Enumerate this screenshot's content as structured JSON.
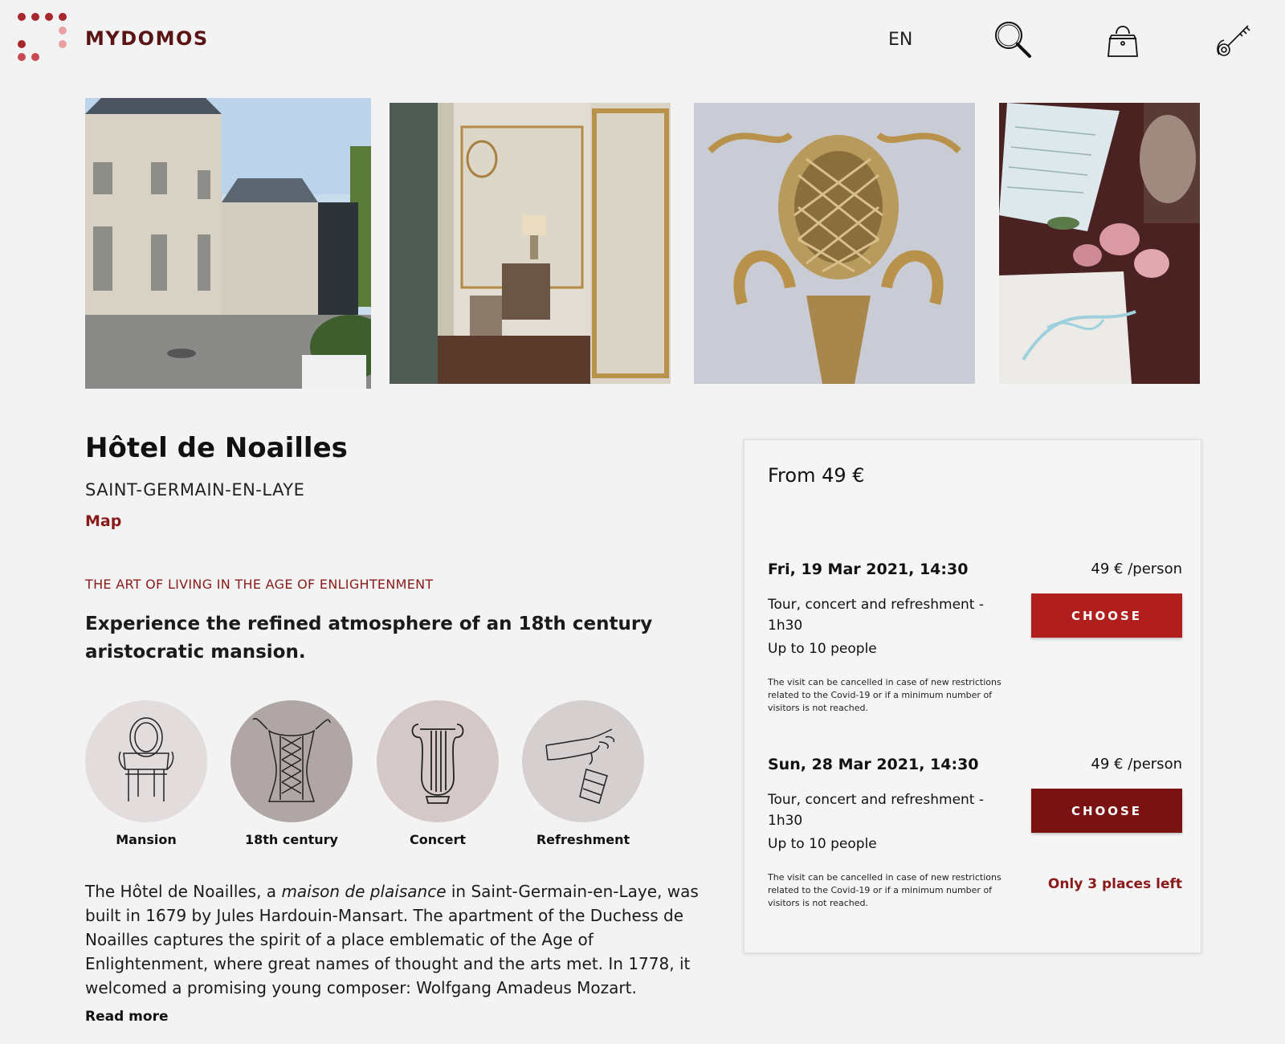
{
  "header": {
    "brand": "MYDOMOS",
    "language": "EN",
    "icons": [
      "search-icon",
      "bag-icon",
      "key-icon"
    ]
  },
  "gallery": [
    {
      "name": "courtyard-photo"
    },
    {
      "name": "salon-photo"
    },
    {
      "name": "gilded-ornament-photo"
    },
    {
      "name": "flowers-invitation-photo"
    }
  ],
  "venue": {
    "title": "Hôtel de Noailles",
    "city": "SAINT-GERMAIN-EN-LAYE",
    "map_link": "Map",
    "tagline": "THE ART OF LIVING IN THE AGE OF ENLIGHTENMENT",
    "lead": "Experience the refined atmosphere of an 18th century aristocratic mansion.",
    "features": [
      {
        "label": "Mansion",
        "icon": "armchair-icon",
        "color": "#e2dcdc"
      },
      {
        "label": "18th century",
        "icon": "corset-icon",
        "color": "#b0a6a6"
      },
      {
        "label": "Concert",
        "icon": "lyre-icon",
        "color": "#d4c8c8"
      },
      {
        "label": "Refreshment",
        "icon": "hand-pouring-icon",
        "color": "#d6cfcf"
      }
    ],
    "description_part1": "The Hôtel de Noailles, a ",
    "description_italic": "maison de plaisance",
    "description_part2": " in Saint-Germain-en-Laye, was built in 1679 by Jules Hardouin-Mansart. The apartment of the Duchess de Noailles captures the spirit of a place emblematic of the Age of Enlightenment, where great names of thought and the arts met. In 1778, it welcomed a promising young composer: Wolfgang Amadeus Mozart.",
    "read_more": "Read more"
  },
  "booking": {
    "from_price": "From 49 €",
    "slots": [
      {
        "date": "Fri, 19 Mar 2021, 14:30",
        "price": "49 € /person",
        "tour": "Tour, concert and refreshment - 1h30",
        "people": "Up to 10 people",
        "note": "The visit can be cancelled in case of new restrictions related to the Covid-19 or if a minimum number of visitors is not reached.",
        "button": "CHOOSE",
        "button_color": "#b01e1e",
        "places_left": ""
      },
      {
        "date": "Sun, 28 Mar 2021, 14:30",
        "price": "49 € /person",
        "tour": "Tour, concert and refreshment - 1h30",
        "people": "Up to 10 people",
        "note": "The visit can be cancelled in case of new restrictions related to the Covid-19 or if a minimum number of visitors is not reached.",
        "button": "CHOOSE",
        "button_color": "#7a1212",
        "places_left": "Only 3 places left"
      }
    ]
  },
  "colors": {
    "accent": "#8a1a1a",
    "background": "#f3f3f3"
  }
}
